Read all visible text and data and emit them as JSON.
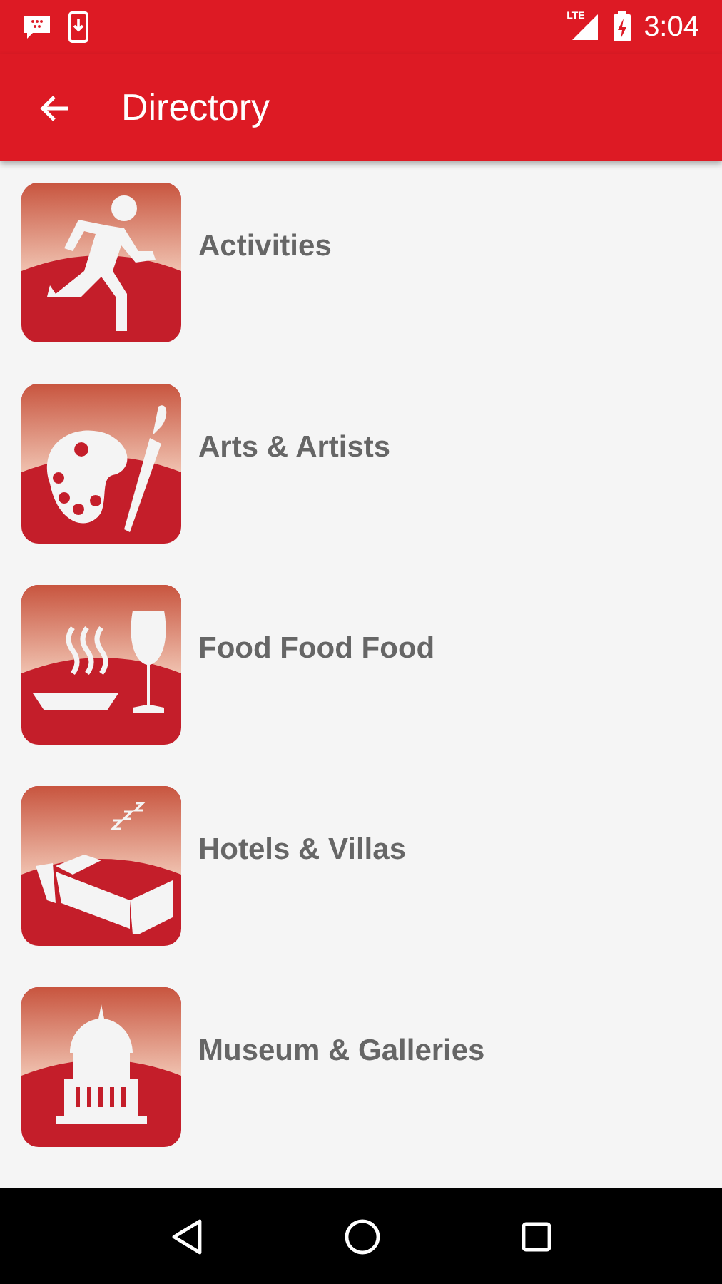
{
  "status_bar": {
    "time": "3:04",
    "network": "LTE"
  },
  "toolbar": {
    "title": "Directory"
  },
  "items": [
    {
      "label": "Activities",
      "kind": "runner"
    },
    {
      "label": "Arts & Artists",
      "kind": "palette"
    },
    {
      "label": "Food Food Food",
      "kind": "food"
    },
    {
      "label": "Hotels & Villas",
      "kind": "bed"
    },
    {
      "label": "Museum & Galleries",
      "kind": "building"
    }
  ]
}
